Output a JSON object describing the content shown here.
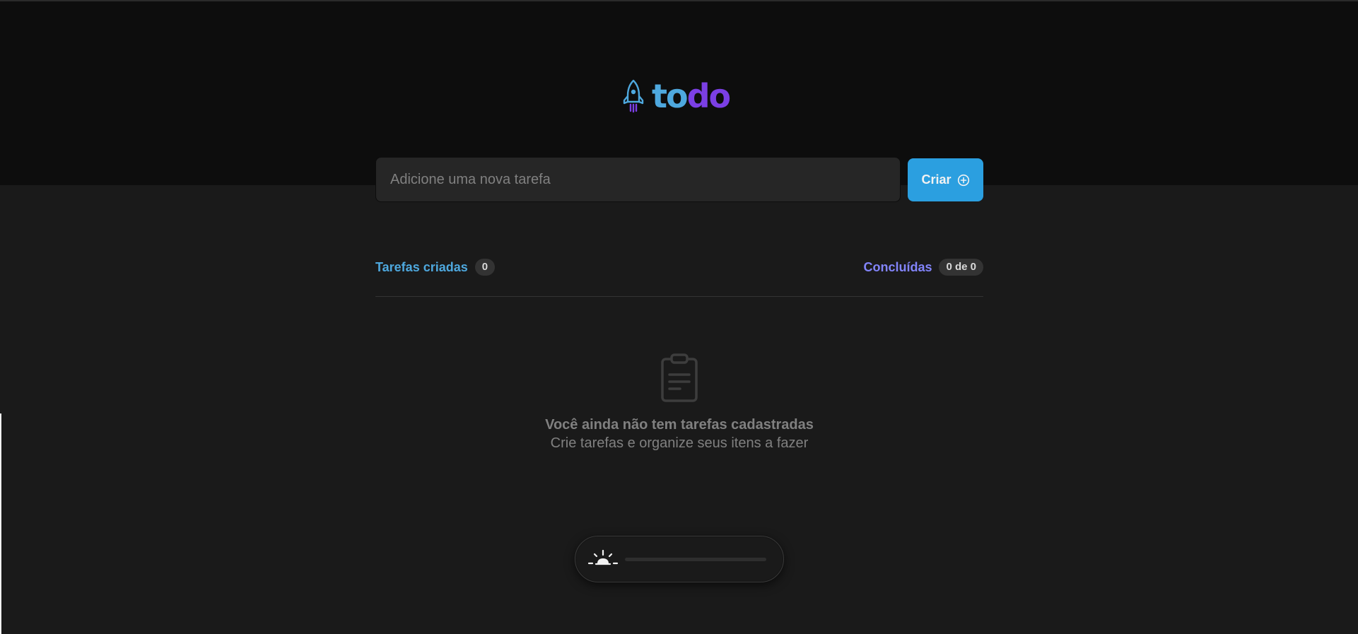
{
  "app": {
    "logo_prefix": "to",
    "logo_suffix": "do",
    "icon": "rocket-icon"
  },
  "new_task": {
    "placeholder": "Adicione uma nova tarefa",
    "value": ""
  },
  "create_button": {
    "label": "Criar",
    "icon": "plus-circle-icon"
  },
  "counters": {
    "created_label": "Tarefas criadas",
    "created_count": "0",
    "done_label": "Concluídas",
    "done_count": "0 de 0"
  },
  "empty_state": {
    "icon": "clipboard-icon",
    "title": "Você ainda não tem tarefas cadastradas",
    "subtitle": "Crie tarefas e organize seus itens a fazer"
  },
  "theme_toggle": {
    "icon": "sunrise-icon"
  },
  "colors": {
    "blue": "#4ea8de",
    "purple": "#8284fa",
    "button": "#2b9fe0",
    "background": "#1a1a1a",
    "header": "#0d0d0d"
  }
}
